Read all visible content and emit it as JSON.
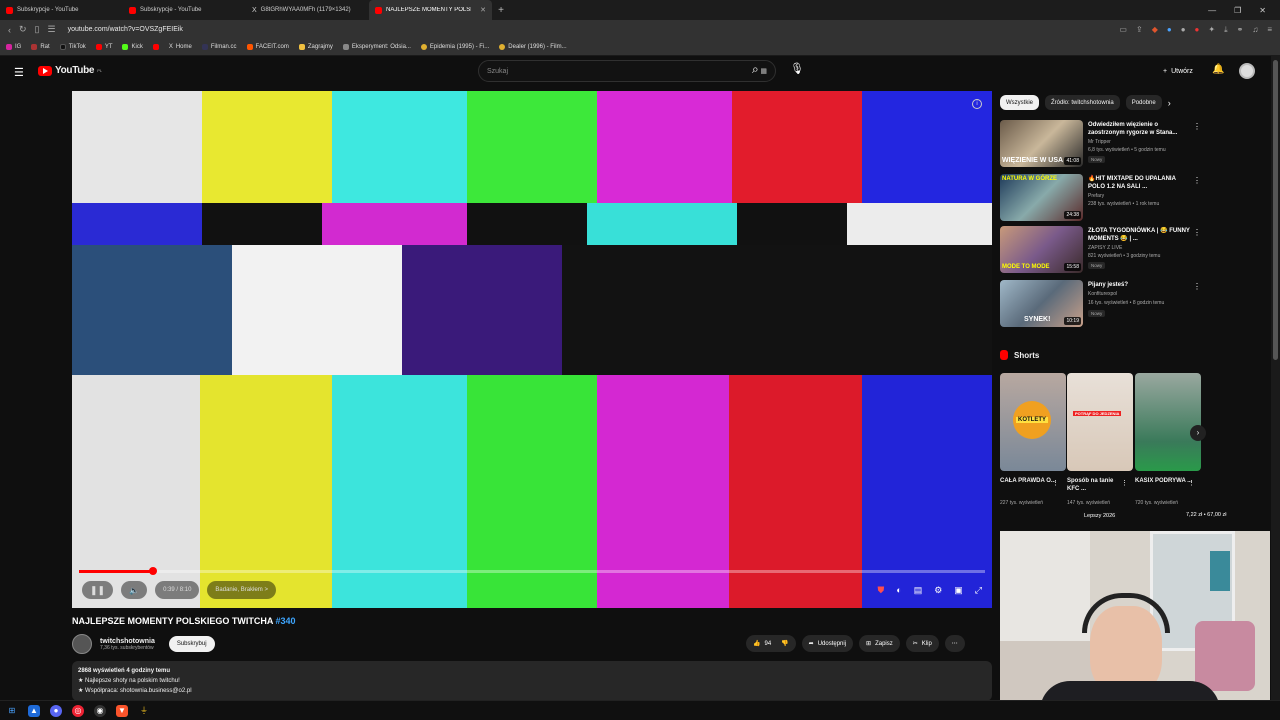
{
  "browser": {
    "tabs": [
      {
        "title": "Subskrypcje - YouTube",
        "active": false,
        "color": "#ff0000"
      },
      {
        "title": "Subskrypcje - YouTube",
        "active": false,
        "color": "#ff0000"
      },
      {
        "title": "G8tGRhWYAA0MFh (1179×1342)",
        "active": false,
        "color": "#ffffff"
      },
      {
        "title": "NAJLEPSZE MOMENTY POLSKIEGO TWITCHA",
        "active": true,
        "color": "#ff0000"
      }
    ],
    "url": "youtube.com/watch?v=OVSZgFEIEik",
    "bookmarks": [
      "IG",
      "Rat",
      "TikTok",
      "YT",
      "Kick",
      "Home",
      "Filman.cc",
      "FACEIT.com",
      "Zagrajmy",
      "Eksperyment: Odsia...",
      "Epidemia (1995) - Fi...",
      "Dealer (1996) - Film..."
    ]
  },
  "header": {
    "logo_text": "YouTube",
    "logo_country": "PL",
    "search_placeholder": "Szukaj",
    "create_label": "Utwórz"
  },
  "player": {
    "time": "0:39 / 8:10",
    "chapter": "Badanie, Brakłem >",
    "progress_fraction": 0.082
  },
  "video": {
    "title": "NAJLEPSZE MOMENTY POLSKIEGO TWITCHA",
    "hashtag": "#340",
    "channel": "twitchshotownia",
    "subs": "7,36 tys. subskrybentów",
    "subscribe_label": "Subskrybuj",
    "likes": "94",
    "share": "Udostępnij",
    "save": "Zapisz",
    "clip": "Klip",
    "desc_line1": "2868 wyświetleń  4 godziny temu",
    "desc_line2": "★ Najlepsze shoty na polskim twitchu!",
    "desc_line3": "★ Współpraca: shotownia.business@o2.pl"
  },
  "sidebar": {
    "chips": [
      "Wszystkie",
      "Źródło: twitchshotownia",
      "Podobne"
    ],
    "recs": [
      {
        "title": "Odwiedziłem więzienie o zaostrzonym rygorze w Stana...",
        "channel": "Mr Tripper",
        "views": "6,8 tys. wyświetleń • 5 godzin temu",
        "badge": "Nowy",
        "duration": "41:08",
        "thumb_text": "WIĘZIENIE W USA"
      },
      {
        "title": "🔥HIT MIXTAPE DO UPALANIA POLO 1.2 NA SALI ...",
        "channel": "Prefary",
        "views": "238 tys. wyświetleń • 1 rok temu",
        "badge": "",
        "duration": "24:38",
        "thumb_text": "NATURA W GÓRZE"
      },
      {
        "title": "ZŁOTA TYGODNIÓWKA | 😂 FUNNY MOMENTS 😂 | ...",
        "channel": "ZAPISY Z LIVE",
        "views": "821 wyświetleń • 3 godziny temu",
        "badge": "Nowy",
        "duration": "15:58",
        "thumb_text": "MODE TO MODE"
      },
      {
        "title": "Pijany jesteś?",
        "channel": "Konfiturexpol",
        "views": "16 tys. wyświetleń • 8 godzin temu",
        "badge": "Nowy",
        "duration": "10:19",
        "thumb_text": "SYNEK!"
      }
    ],
    "shorts_title": "Shorts",
    "shorts": [
      {
        "title": "CAŁA PRAWDA O...",
        "views": "227 tys. wyświetleń",
        "thumb_text": "KOTLETY"
      },
      {
        "title": "Sposób na tanie KFC ...",
        "views": "147 tys. wyświetleń",
        "thumb_text": "POTRĄF DO JEDZENIA"
      },
      {
        "title": "KASIX PODRYWA ...",
        "views": "720 tys. wyświetleń",
        "thumb_text": ""
      }
    ],
    "tooltip": "Lepszy 2026",
    "price": "7,22 zł • 67,00 zł"
  },
  "colors": {
    "accent": "#ff0000",
    "link": "#3ea6ff",
    "bg": "#0f0f0f"
  }
}
